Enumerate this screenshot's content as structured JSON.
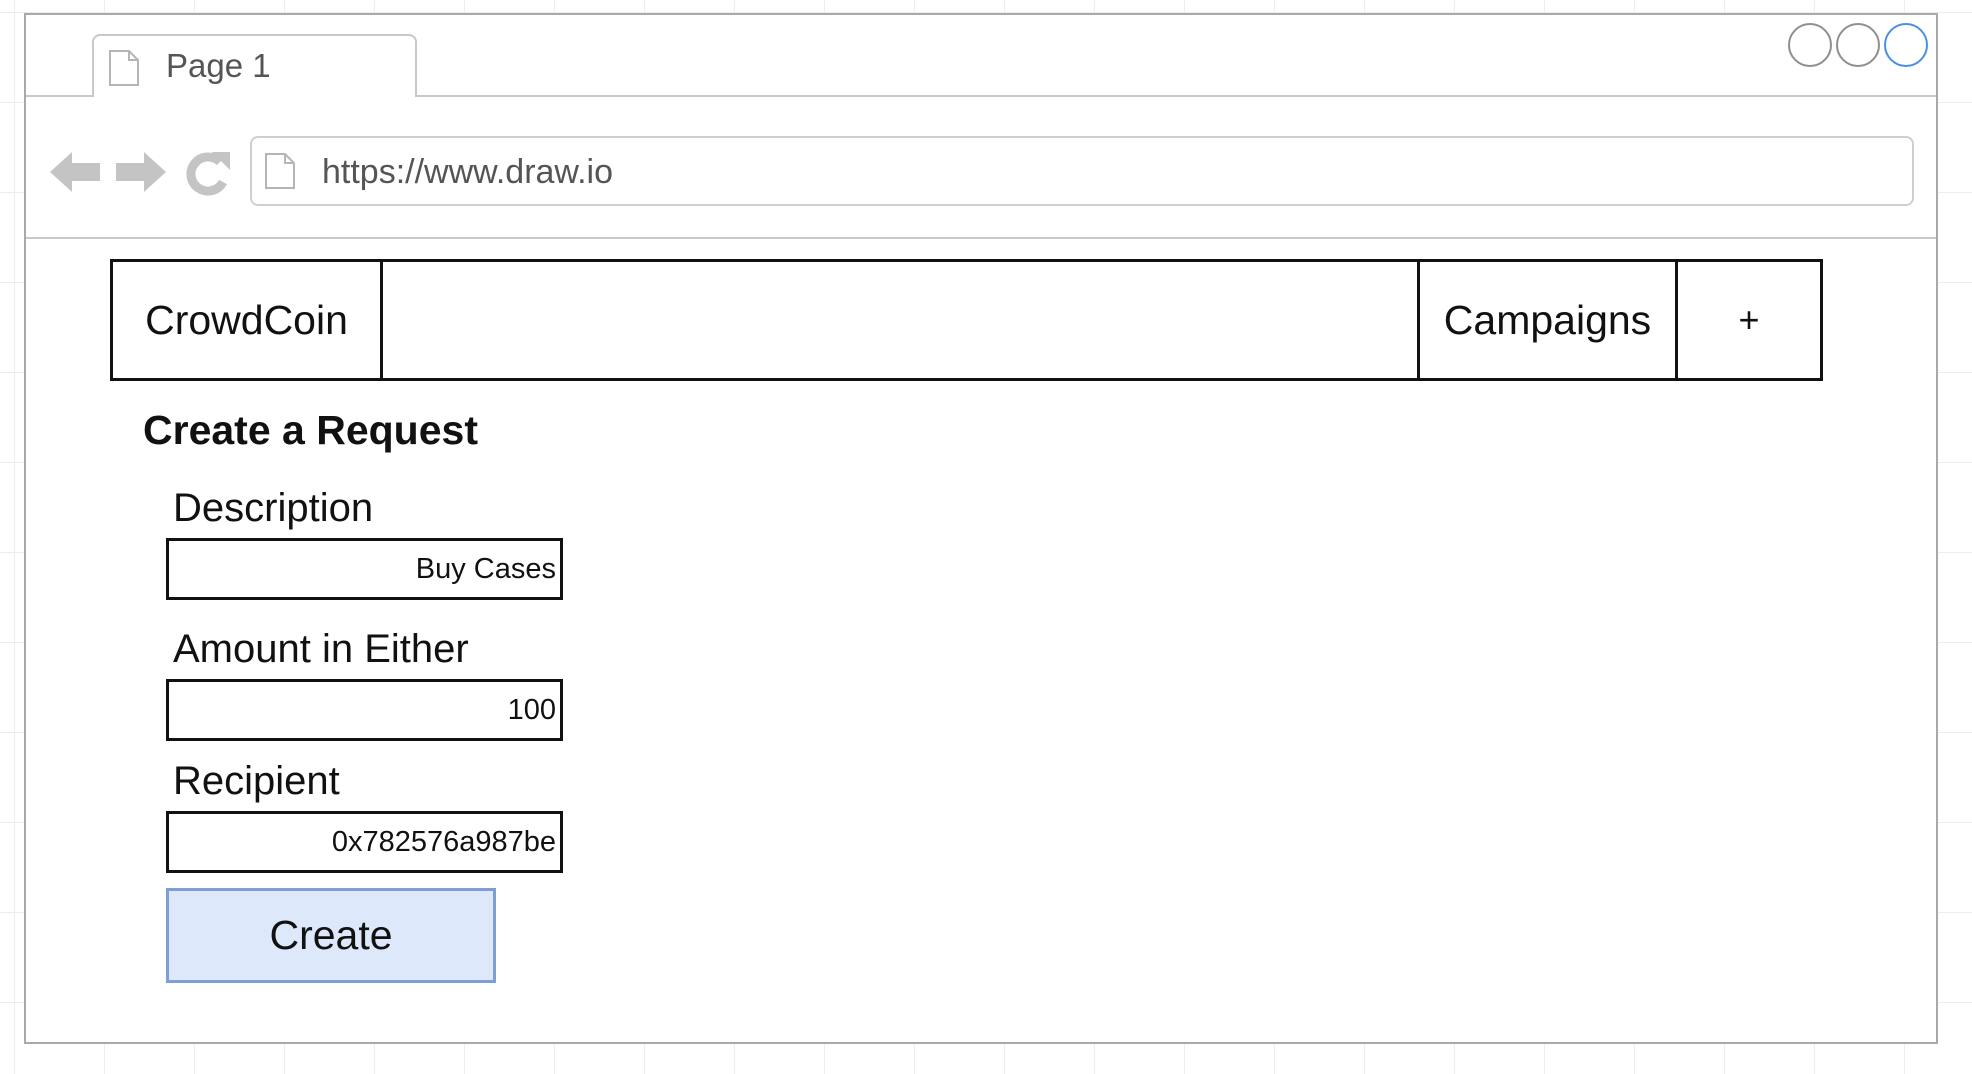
{
  "browser": {
    "tab_label": "Page 1",
    "url": "https://www.draw.io",
    "accent_color": "#4a90e2"
  },
  "app": {
    "brand": "CrowdCoin",
    "nav_campaigns": "Campaigns",
    "nav_add": "+"
  },
  "form": {
    "heading": "Create a Request",
    "description_label": "Description",
    "description_value": "Buy Cases",
    "amount_label": "Amount in Either",
    "amount_value": "100",
    "recipient_label": "Recipient",
    "recipient_value": "0x782576a987be",
    "submit_label": "Create",
    "submit_color": "#dde8fb"
  }
}
